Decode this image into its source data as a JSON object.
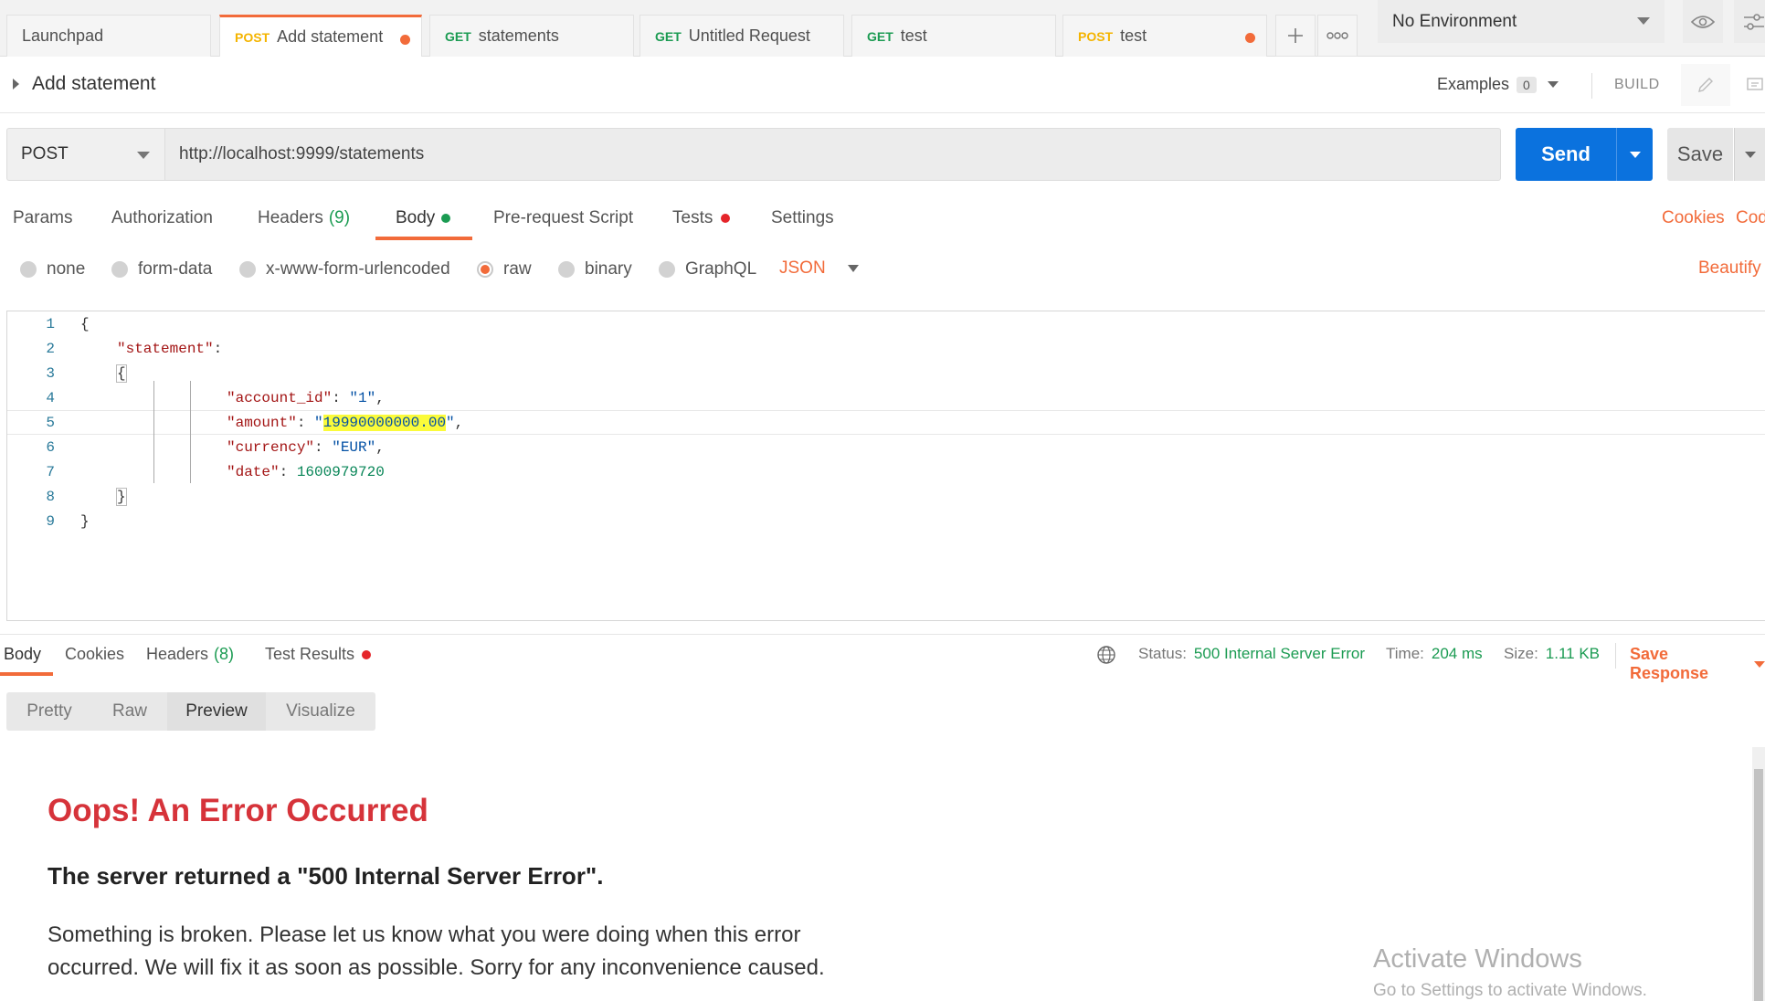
{
  "tabs": [
    {
      "method": "",
      "label": "Launchpad"
    },
    {
      "method": "POST",
      "label": "Add statement",
      "unsaved": true
    },
    {
      "method": "GET",
      "label": "statements"
    },
    {
      "method": "GET",
      "label": "Untitled Request"
    },
    {
      "method": "GET",
      "label": "test"
    },
    {
      "method": "POST",
      "label": "test",
      "unsaved": true
    }
  ],
  "environment": {
    "selected": "No Environment"
  },
  "request": {
    "name": "Add statement",
    "examples_label": "Examples",
    "examples_count": "0",
    "build_label": "BUILD",
    "method": "POST",
    "url": "http://localhost:9999/statements",
    "send_label": "Send",
    "save_label": "Save"
  },
  "request_tabs": {
    "params": "Params",
    "authorization": "Authorization",
    "headers": "Headers",
    "headers_count": "(9)",
    "body": "Body",
    "prerequest": "Pre-request Script",
    "tests": "Tests",
    "settings": "Settings",
    "cookies": "Cookies",
    "code": "Cod"
  },
  "body_types": {
    "none": "none",
    "form_data": "form-data",
    "urlencoded": "x-www-form-urlencoded",
    "raw": "raw",
    "binary": "binary",
    "graphql": "GraphQL",
    "format": "JSON",
    "beautify": "Beautify"
  },
  "editor": {
    "line_numbers": [
      "1",
      "2",
      "3",
      "4",
      "5",
      "6",
      "7",
      "8",
      "9"
    ],
    "open_brace": "{",
    "close_brace": "}",
    "statement_key": "\"statement\"",
    "account_id_key": "\"account_id\"",
    "account_id_value": "\"1\"",
    "amount_key": "\"amount\"",
    "amount_value": "19990000000.00",
    "currency_key": "\"currency\"",
    "currency_value": "\"EUR\"",
    "date_key": "\"date\"",
    "date_value": "1600979720"
  },
  "response": {
    "tabs": {
      "body": "Body",
      "cookies": "Cookies",
      "headers": "Headers",
      "headers_count": "(8)",
      "test_results": "Test Results"
    },
    "status_label": "Status:",
    "status_value": "500 Internal Server Error",
    "time_label": "Time:",
    "time_value": "204 ms",
    "size_label": "Size:",
    "size_value": "1.11 KB",
    "save_response": "Save Response",
    "views": [
      "Pretty",
      "Raw",
      "Preview",
      "Visualize"
    ],
    "preview": {
      "title": "Oops! An Error Occurred",
      "subtitle": "The server returned a \"500 Internal Server Error\".",
      "body": "Something is broken. Please let us know what you were doing when this error occurred. We will fix it as soon as possible. Sorry for any inconvenience caused."
    }
  },
  "watermark": {
    "line1": "Activate Windows",
    "line2": "Go to Settings to activate Windows."
  }
}
